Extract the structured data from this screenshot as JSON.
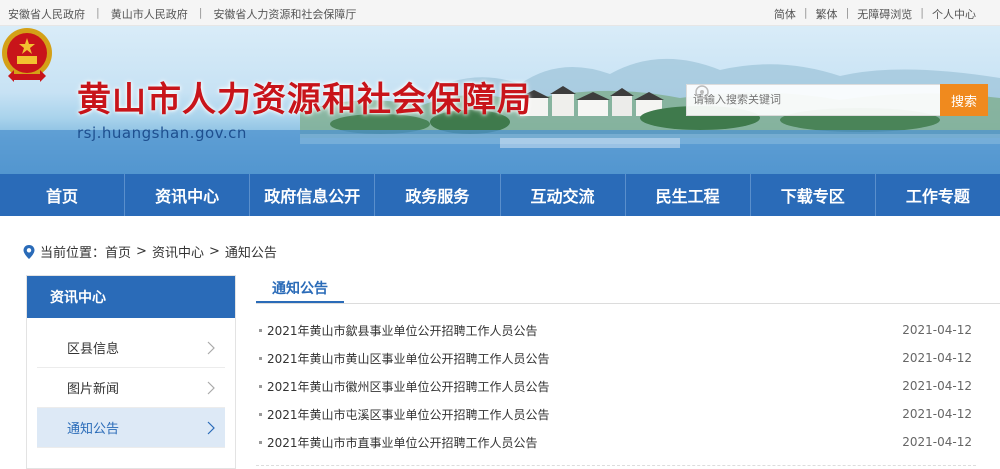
{
  "topbar": {
    "left_links": [
      "安徽省人民政府",
      "黄山市人民政府",
      "安徽省人力资源和社会保障厅"
    ],
    "right_links": [
      "简体",
      "繁体",
      "无障碍浏览",
      "个人中心"
    ]
  },
  "header": {
    "title": "黄山市人力资源和社会保障局",
    "domain": "rsj.huangshan.gov.cn",
    "title_color": "#c8141a"
  },
  "search": {
    "placeholder": "请输入搜索关键词",
    "button_label": "搜索",
    "button_color": "#f08a1e"
  },
  "nav": {
    "color": "#2a6bb8",
    "items": [
      "首页",
      "资讯中心",
      "政府信息公开",
      "政务服务",
      "互动交流",
      "民生工程",
      "下载专区",
      "工作专题"
    ]
  },
  "breadcrumb": {
    "prefix": "当前位置：",
    "items": [
      "首页",
      "资讯中心",
      "通知公告"
    ],
    "separator": ">"
  },
  "sidebar": {
    "title": "资讯中心",
    "items": [
      {
        "label": "区县信息",
        "active": false
      },
      {
        "label": "图片新闻",
        "active": false
      },
      {
        "label": "通知公告",
        "active": true
      }
    ]
  },
  "main": {
    "section_title": "通知公告",
    "articles": [
      {
        "title": "2021年黄山市歙县事业单位公开招聘工作人员公告",
        "date": "2021-04-12"
      },
      {
        "title": "2021年黄山市黄山区事业单位公开招聘工作人员公告",
        "date": "2021-04-12"
      },
      {
        "title": "2021年黄山市徽州区事业单位公开招聘工作人员公告",
        "date": "2021-04-12"
      },
      {
        "title": "2021年黄山市屯溪区事业单位公开招聘工作人员公告",
        "date": "2021-04-12"
      },
      {
        "title": "2021年黄山市市直事业单位公开招聘工作人员公告",
        "date": "2021-04-12"
      }
    ]
  }
}
